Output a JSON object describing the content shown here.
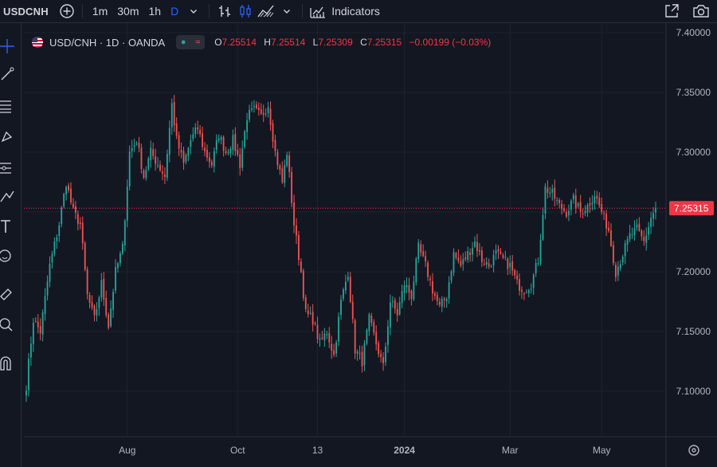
{
  "toolbar": {
    "symbol": "USDCNH",
    "intervals": [
      "1m",
      "30m",
      "1h",
      "D"
    ],
    "active_interval": "D",
    "indicators_label": "Indicators"
  },
  "legend": {
    "title": "USD/CNH · 1D · OANDA",
    "o_label": "O",
    "o_value": "7.25514",
    "h_label": "H",
    "h_value": "7.25514",
    "l_label": "L",
    "l_value": "7.25309",
    "c_label": "C",
    "c_value": "7.25315",
    "change": "−0.00199 (−0.03%)"
  },
  "colors": {
    "up": "#26a69a",
    "down": "#ef5350",
    "background": "#131722",
    "accent": "#2962ff",
    "price_label": "#f23645"
  },
  "icons": [
    "plus-circle-icon",
    "chevron-down-icon",
    "bar-style-icon",
    "candle-style-icon",
    "area-style-icon",
    "indicators-icon",
    "fullscreen-icon",
    "camera-icon",
    "crosshair-icon",
    "trendline-icon",
    "fib-icon",
    "brush-icon",
    "measure-icon",
    "text-icon",
    "emoji-icon",
    "ruler-icon",
    "zoom-icon",
    "magnet-icon",
    "settings-icon"
  ],
  "chart_data": {
    "type": "candlestick",
    "y_ticks": [
      "7.40000",
      "7.35000",
      "7.30000",
      "7.25000",
      "7.20000",
      "7.15000",
      "7.10000"
    ],
    "x_ticks": [
      {
        "label": "Aug",
        "bold": false
      },
      {
        "label": "Oct",
        "bold": false
      },
      {
        "label": "13",
        "bold": false
      },
      {
        "label": "2024",
        "bold": true
      },
      {
        "label": "Mar",
        "bold": false
      },
      {
        "label": "May",
        "bold": false
      }
    ],
    "last_price": "7.25315",
    "ylim": [
      7.05,
      7.4
    ],
    "anchors": [
      [
        0,
        7.105
      ],
      [
        3,
        7.16
      ],
      [
        6,
        7.15
      ],
      [
        10,
        7.205
      ],
      [
        14,
        7.24
      ],
      [
        17,
        7.275
      ],
      [
        20,
        7.25
      ],
      [
        23,
        7.24
      ],
      [
        26,
        7.18
      ],
      [
        29,
        7.16
      ],
      [
        32,
        7.19
      ],
      [
        35,
        7.155
      ],
      [
        38,
        7.2
      ],
      [
        41,
        7.22
      ],
      [
        44,
        7.3
      ],
      [
        47,
        7.31
      ],
      [
        50,
        7.28
      ],
      [
        53,
        7.3
      ],
      [
        56,
        7.29
      ],
      [
        59,
        7.28
      ],
      [
        62,
        7.34
      ],
      [
        64,
        7.31
      ],
      [
        67,
        7.29
      ],
      [
        70,
        7.31
      ],
      [
        73,
        7.32
      ],
      [
        76,
        7.3
      ],
      [
        79,
        7.29
      ],
      [
        82,
        7.315
      ],
      [
        85,
        7.3
      ],
      [
        88,
        7.31
      ],
      [
        91,
        7.29
      ],
      [
        94,
        7.33
      ],
      [
        97,
        7.335
      ],
      [
        100,
        7.33
      ],
      [
        103,
        7.34
      ],
      [
        106,
        7.3
      ],
      [
        109,
        7.275
      ],
      [
        111,
        7.3
      ],
      [
        114,
        7.24
      ],
      [
        117,
        7.2
      ],
      [
        119,
        7.165
      ],
      [
        122,
        7.16
      ],
      [
        125,
        7.14
      ],
      [
        128,
        7.15
      ],
      [
        131,
        7.13
      ],
      [
        134,
        7.175
      ],
      [
        137,
        7.2
      ],
      [
        140,
        7.135
      ],
      [
        143,
        7.125
      ],
      [
        146,
        7.16
      ],
      [
        149,
        7.14
      ],
      [
        152,
        7.12
      ],
      [
        155,
        7.175
      ],
      [
        158,
        7.165
      ],
      [
        161,
        7.19
      ],
      [
        164,
        7.18
      ],
      [
        167,
        7.22
      ],
      [
        170,
        7.205
      ],
      [
        173,
        7.185
      ],
      [
        176,
        7.17
      ],
      [
        179,
        7.18
      ],
      [
        182,
        7.215
      ],
      [
        185,
        7.205
      ],
      [
        188,
        7.215
      ],
      [
        191,
        7.225
      ],
      [
        194,
        7.21
      ],
      [
        197,
        7.205
      ],
      [
        200,
        7.215
      ],
      [
        203,
        7.21
      ],
      [
        206,
        7.205
      ],
      [
        209,
        7.19
      ],
      [
        212,
        7.185
      ],
      [
        215,
        7.19
      ],
      [
        218,
        7.21
      ],
      [
        221,
        7.27
      ],
      [
        224,
        7.265
      ],
      [
        227,
        7.255
      ],
      [
        230,
        7.25
      ],
      [
        233,
        7.26
      ],
      [
        236,
        7.25
      ],
      [
        239,
        7.255
      ],
      [
        242,
        7.265
      ],
      [
        245,
        7.25
      ],
      [
        248,
        7.235
      ],
      [
        251,
        7.2
      ],
      [
        254,
        7.215
      ],
      [
        257,
        7.23
      ],
      [
        260,
        7.235
      ],
      [
        263,
        7.225
      ],
      [
        266,
        7.245
      ],
      [
        268,
        7.25315
      ]
    ]
  }
}
